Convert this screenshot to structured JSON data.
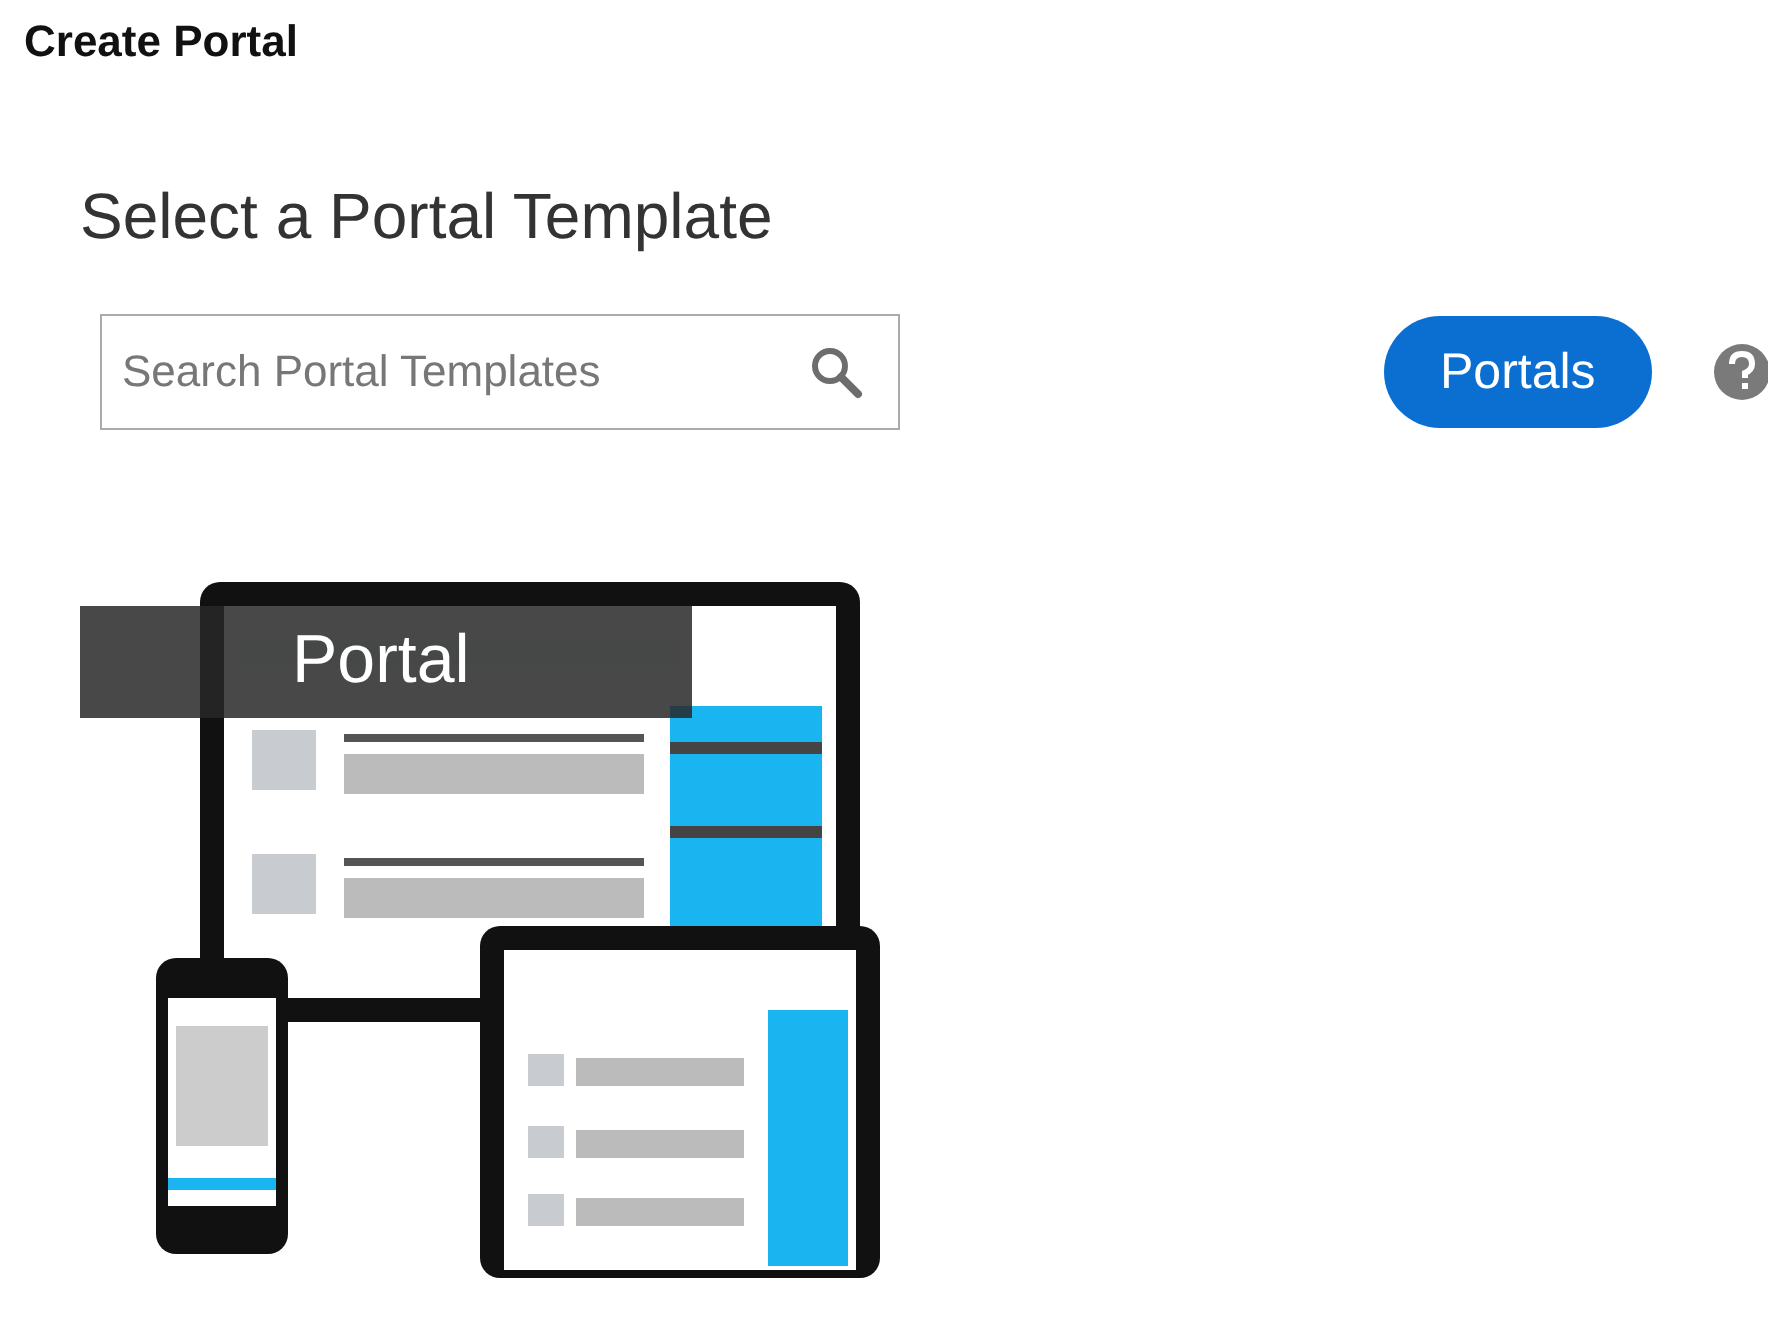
{
  "page_title": "Create Portal",
  "heading": "Select a Portal Template",
  "search": {
    "placeholder": "Search Portal Templates"
  },
  "filter_button": "Portals",
  "templates": [
    {
      "label": "Portal"
    }
  ]
}
